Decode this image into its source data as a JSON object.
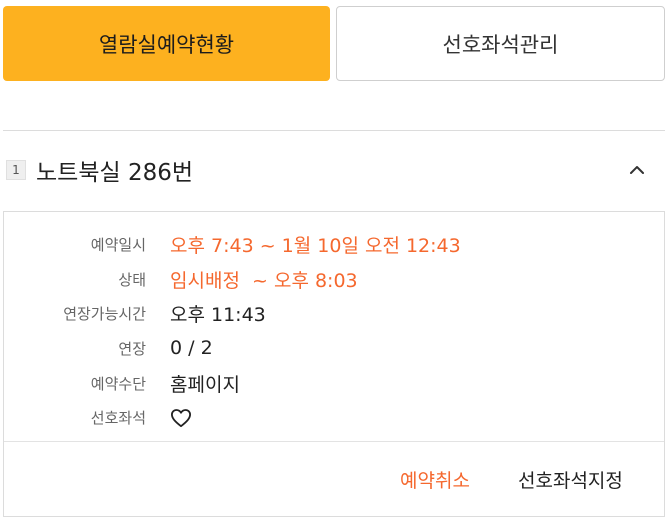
{
  "tabs": [
    {
      "label": "열람실예약현황",
      "active": true
    },
    {
      "label": "선호좌석관리",
      "active": false
    }
  ],
  "room": {
    "index": "1",
    "title": "노트북실 286번"
  },
  "details": {
    "reservation_label": "예약일시",
    "reservation_value": "오후 7:43 ~ 1월 10일 오전 12:43",
    "status_label": "상태",
    "status_value": "임시배정  ~ 오후 8:03",
    "extend_time_label": "연장가능시간",
    "extend_time_value": "오후 11:43",
    "extend_label": "연장",
    "extend_value": "0 / 2",
    "method_label": "예약수단",
    "method_value": "홈페이지",
    "favorite_label": "선호좌석"
  },
  "actions": {
    "cancel_label": "예약취소",
    "favorite_label": "선호좌석지정"
  },
  "colors": {
    "accent": "#fdb11f",
    "highlight": "#f5682e"
  },
  "icons": {
    "collapse": "chevron-up-icon",
    "favorite": "heart-outline-icon"
  }
}
